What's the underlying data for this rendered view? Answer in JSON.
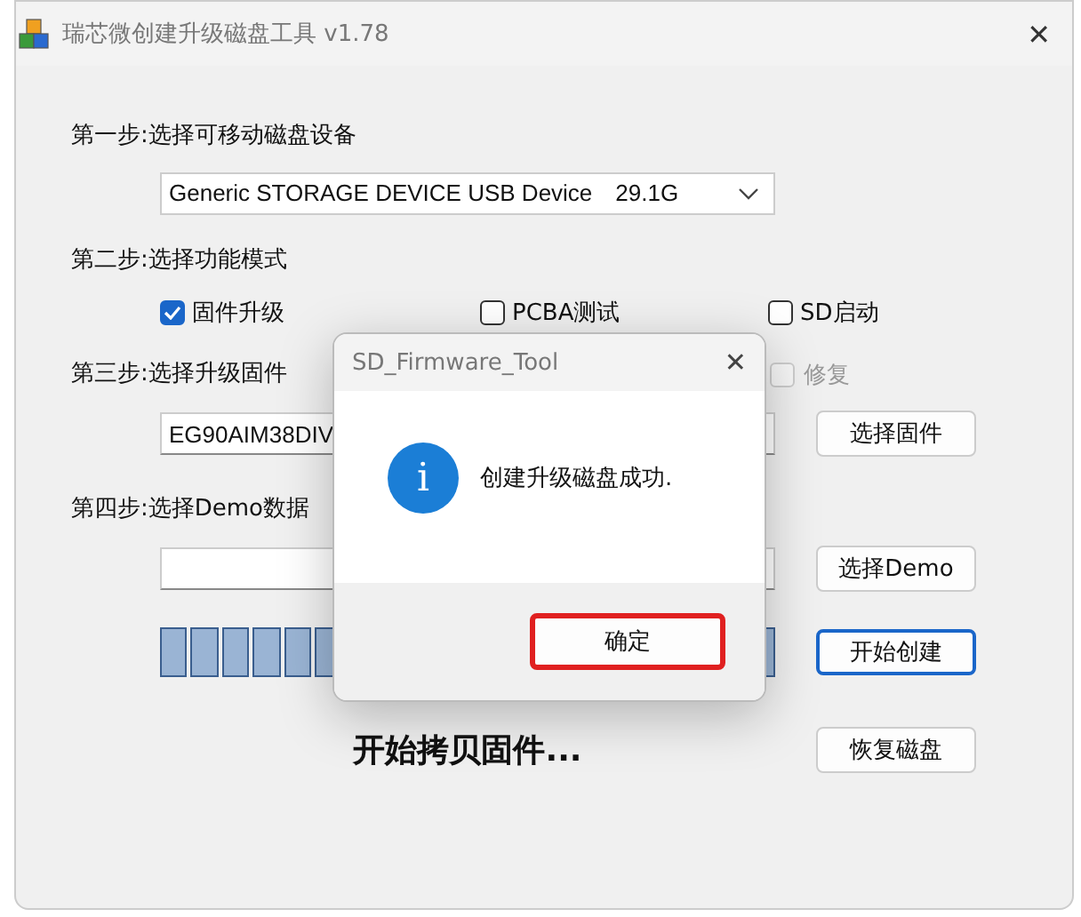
{
  "window": {
    "title": "瑞芯微创建升级磁盘工具 v1.78",
    "close": "✕"
  },
  "steps": [
    {
      "label": "第一步:选择可移动磁盘设备",
      "kind": "combo",
      "value": "Generic STORAGE DEVICE USB Device　29.1G"
    },
    {
      "label": "第二步:选择功能模式",
      "kind": "modes",
      "options": [
        {
          "label": "固件升级",
          "checked": true,
          "disabled": false
        },
        {
          "label": "PCBA测试",
          "checked": false,
          "disabled": false
        },
        {
          "label": "SD启动",
          "checked": false,
          "disabled": false
        }
      ]
    },
    {
      "label": "第三步:选择升级固件",
      "kind": "file",
      "value": "EG90AIM38DIV",
      "button": "选择固件",
      "extra": {
        "label": "修复",
        "checked": false,
        "disabled": true
      }
    },
    {
      "label": "第四步:选择Demo数据",
      "kind": "file",
      "button": "选择Demo"
    },
    {
      "kind": "progress",
      "level": 1,
      "button": "开始创建",
      "focused": true
    }
  ],
  "status": {
    "text": "开始拷贝固件...",
    "button": "恢复磁盘"
  },
  "dialog": {
    "title": "SD_Firmware_Tool",
    "close": "✕",
    "icon": "i",
    "message": "创建升级磁盘成功.",
    "button": "确定",
    "highlighted": true
  }
}
